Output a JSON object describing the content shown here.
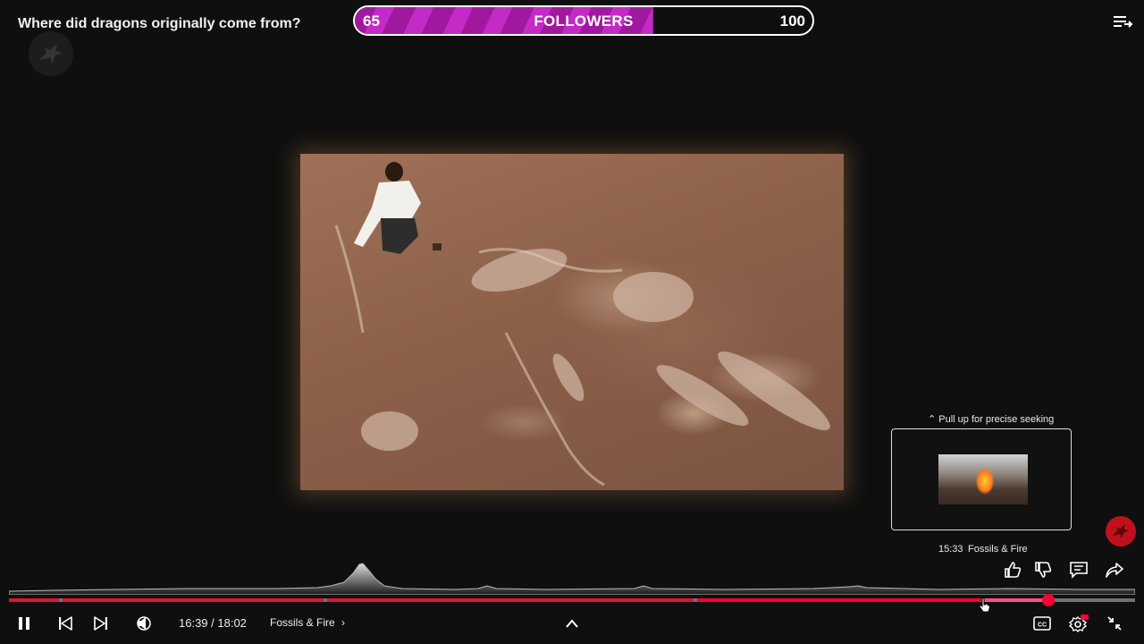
{
  "video": {
    "title": "Where did dragons originally come from?"
  },
  "followers": {
    "current": "65",
    "label": "FOLLOWERS",
    "goal": "100",
    "fill_fraction": 0.65,
    "fill_color": "#a0189e"
  },
  "preview": {
    "hint": "Pull up for precise seeking",
    "time": "15:33",
    "chapter": "Fossils & Fire"
  },
  "player": {
    "current_time": "16:39",
    "duration": "18:02",
    "time_display": "16:39 / 18:02",
    "chapter": "Fossils & Fire",
    "progress_fraction": 0.923,
    "hover_fraction": 0.866,
    "accent_color": "#ff0033",
    "hover_color": "#ff4e8a"
  },
  "icons": {
    "queue": "playlist-icon",
    "pause": "pause-icon",
    "prev": "skip-previous-icon",
    "next": "skip-next-icon",
    "volume": "volume-icon",
    "expand": "chevron-up-icon",
    "like": "thumb-up-icon",
    "dislike": "thumb-down-icon",
    "comments": "comment-icon",
    "share": "share-icon",
    "cc": "closed-captions-icon",
    "settings": "settings-icon",
    "exit_fullscreen": "exit-fullscreen-icon",
    "brand": "pegasus-logo-icon"
  }
}
